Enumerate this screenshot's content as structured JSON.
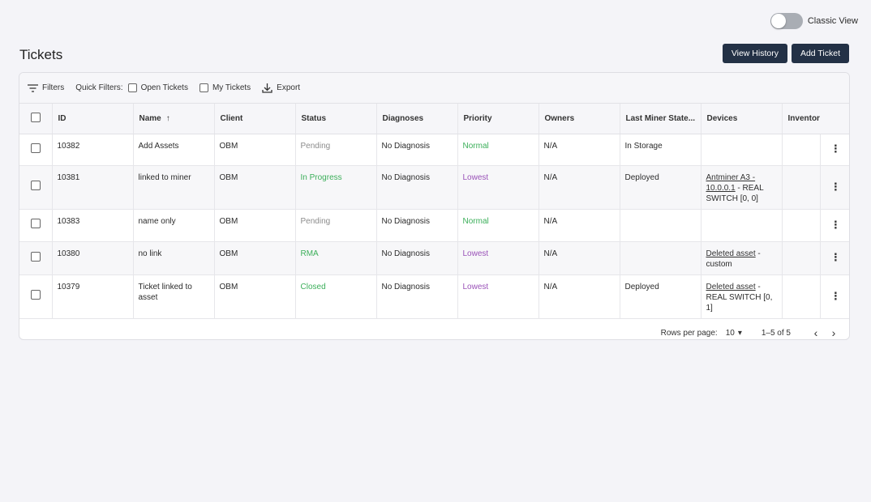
{
  "view_toggle": {
    "label": "Classic View"
  },
  "page_title": "Tickets",
  "header_buttons": {
    "view_history": "View History",
    "add_ticket": "Add Ticket"
  },
  "toolbar": {
    "filters": "Filters",
    "quick_filters": "Quick Filters:",
    "open_tickets": "Open Tickets",
    "my_tickets": "My Tickets",
    "export": "Export"
  },
  "columns": [
    "ID",
    "Name",
    "Client",
    "Status",
    "Diagnoses",
    "Priority",
    "Owners",
    "Last Miner State...",
    "Devices",
    "Inventor"
  ],
  "rows": [
    {
      "id": "10382",
      "name": "Add Assets",
      "client": "OBM",
      "status": "Pending",
      "diagnoses": "No Diagnosis",
      "priority": "Normal",
      "owners": "N/A",
      "miner_state": "In Storage",
      "device_link": "",
      "device_rest": ""
    },
    {
      "id": "10381",
      "name": "linked to miner",
      "client": "OBM",
      "status": "In Progress",
      "diagnoses": "No Diagnosis",
      "priority": "Lowest",
      "owners": "N/A",
      "miner_state": "Deployed",
      "device_link": "Antminer A3 - 10.0.0.1",
      "device_rest": " - REAL SWITCH [0, 0]"
    },
    {
      "id": "10383",
      "name": "name only",
      "client": "OBM",
      "status": "Pending",
      "diagnoses": "No Diagnosis",
      "priority": "Normal",
      "owners": "N/A",
      "miner_state": "",
      "device_link": "",
      "device_rest": ""
    },
    {
      "id": "10380",
      "name": "no link",
      "client": "OBM",
      "status": "RMA",
      "diagnoses": "No Diagnosis",
      "priority": "Lowest",
      "owners": "N/A",
      "miner_state": "",
      "device_link": "Deleted asset",
      "device_rest": " - custom"
    },
    {
      "id": "10379",
      "name": "Ticket linked to asset",
      "client": "OBM",
      "status": "Closed",
      "diagnoses": "No Diagnosis",
      "priority": "Lowest",
      "owners": "N/A",
      "miner_state": "Deployed",
      "device_link": "Deleted asset",
      "device_rest": " - REAL SWITCH [0, 1]"
    }
  ],
  "footer": {
    "rows_per_page_label": "Rows per page:",
    "rows_per_page_value": "10",
    "range": "1–5 of 5"
  },
  "colors": {
    "primary_button": "#233146",
    "status_green": "#3caf5a",
    "priority_purple": "#9a52b8",
    "pending_gray": "#8c8c8c"
  }
}
